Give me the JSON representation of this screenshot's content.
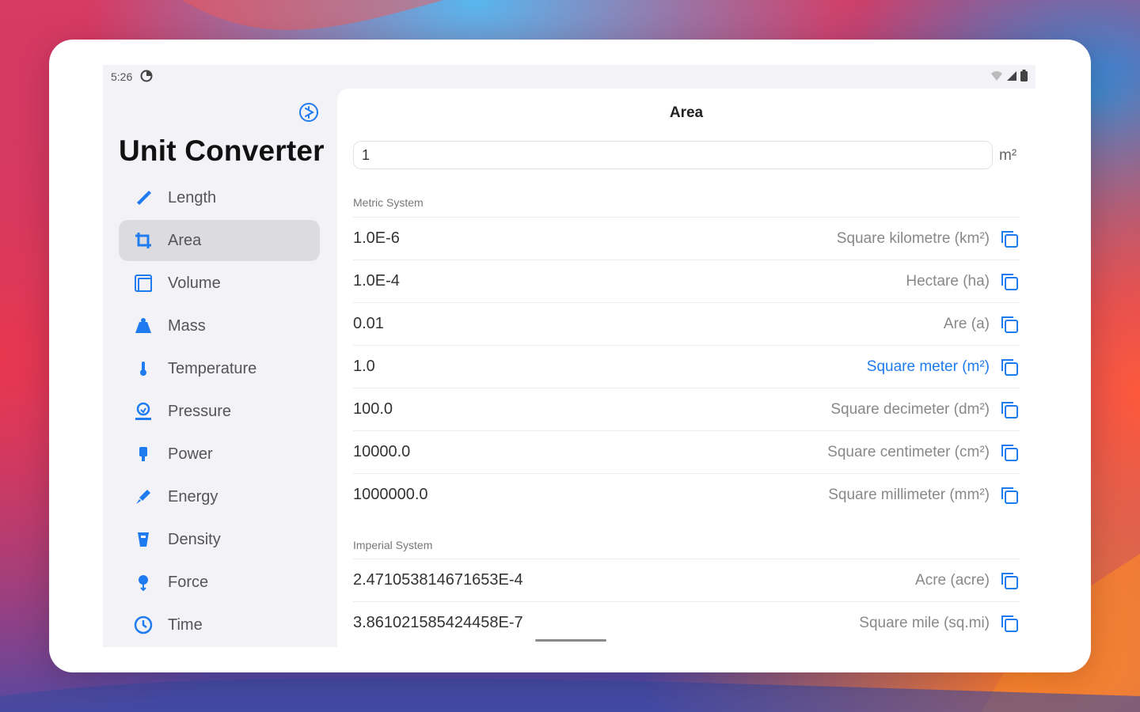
{
  "status": {
    "time": "5:26"
  },
  "app": {
    "title": "Unit Converter"
  },
  "nav": [
    {
      "label": "Length",
      "icon": "ruler-icon",
      "selected": false
    },
    {
      "label": "Area",
      "icon": "crop-icon",
      "selected": true
    },
    {
      "label": "Volume",
      "icon": "volume-icon",
      "selected": false
    },
    {
      "label": "Mass",
      "icon": "weight-icon",
      "selected": false
    },
    {
      "label": "Temperature",
      "icon": "thermometer-icon",
      "selected": false
    },
    {
      "label": "Pressure",
      "icon": "pressure-icon",
      "selected": false
    },
    {
      "label": "Power",
      "icon": "power-icon",
      "selected": false
    },
    {
      "label": "Energy",
      "icon": "energy-icon",
      "selected": false
    },
    {
      "label": "Density",
      "icon": "density-icon",
      "selected": false
    },
    {
      "label": "Force",
      "icon": "force-icon",
      "selected": false
    },
    {
      "label": "Time",
      "icon": "clock-icon",
      "selected": false
    }
  ],
  "main": {
    "title": "Area",
    "input_value": "1",
    "input_unit": "m²",
    "sections": [
      {
        "title": "Metric System",
        "rows": [
          {
            "value": "1.0E-6",
            "unit": "Square kilometre (km²)",
            "highlight": false
          },
          {
            "value": "1.0E-4",
            "unit": "Hectare (ha)",
            "highlight": false
          },
          {
            "value": "0.01",
            "unit": "Are (a)",
            "highlight": false
          },
          {
            "value": "1.0",
            "unit": "Square meter (m²)",
            "highlight": true
          },
          {
            "value": "100.0",
            "unit": "Square decimeter (dm²)",
            "highlight": false
          },
          {
            "value": "10000.0",
            "unit": "Square centimeter (cm²)",
            "highlight": false
          },
          {
            "value": "1000000.0",
            "unit": "Square millimeter (mm²)",
            "highlight": false
          }
        ]
      },
      {
        "title": "Imperial System",
        "rows": [
          {
            "value": "2.471053814671653E-4",
            "unit": "Acre (acre)",
            "highlight": false
          },
          {
            "value": "3.861021585424458E-7",
            "unit": "Square mile (sq.mi)",
            "highlight": false
          }
        ]
      }
    ]
  },
  "colors": {
    "accent": "#1e7bf0",
    "sidebar_bg": "#f2f2f7",
    "selected_bg": "#dcdce0"
  }
}
